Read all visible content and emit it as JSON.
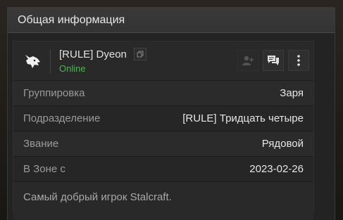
{
  "panel": {
    "title": "Общая информация"
  },
  "profile": {
    "name": "[RULE] Dyeon",
    "status": "Online",
    "status_color": "#3fbf4a"
  },
  "icons": {
    "avatar": "wolf-head-icon",
    "copy": "copy-icon",
    "add_friend": "add-friend-icon",
    "message": "chat-icon",
    "more": "more-vertical-icon"
  },
  "info": [
    {
      "label": "Группировка",
      "value": "Заря"
    },
    {
      "label": "Подразделение",
      "value": "[RULE] Тридцать четыре"
    },
    {
      "label": "Звание",
      "value": "Рядовой"
    },
    {
      "label": "В Зоне с",
      "value": "2023-02-26"
    }
  ],
  "description": "Самый добрый игрок Stalcraft."
}
